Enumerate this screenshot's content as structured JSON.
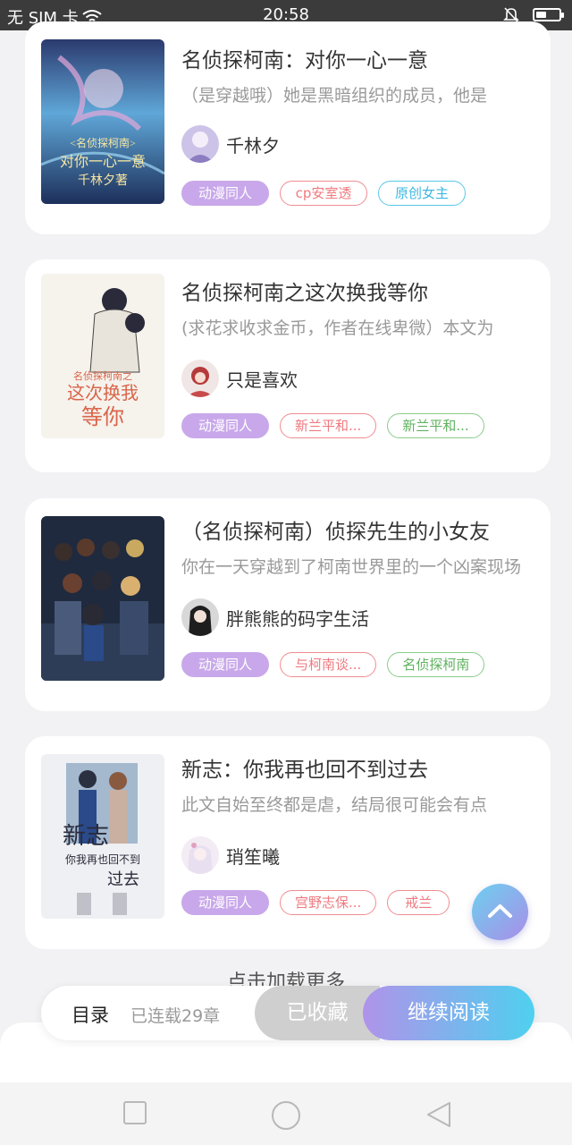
{
  "status_bar": {
    "carrier": "无 SIM 卡",
    "time": "20:58",
    "battery_level": 0.45
  },
  "books": [
    {
      "title": "名侦探柯南：对你一心一意",
      "description": "（是穿越哦）她是黑暗组织的成员，他是",
      "author": "千林夕",
      "tags": [
        "动漫同人",
        "cp安室透",
        "原创女主"
      ],
      "cover_text": [
        "<名侦探柯南>",
        "对你一心一意",
        "千林夕著"
      ]
    },
    {
      "title": "名侦探柯南之这次换我等你",
      "description": "(求花求收求金币，作者在线卑微）本文为",
      "author": "只是喜欢",
      "tags": [
        "动漫同人",
        "新兰平和...",
        "新兰平和..."
      ],
      "cover_text": [
        "名侦探柯南之",
        "这次换我",
        "等你"
      ]
    },
    {
      "title": "（名侦探柯南）侦探先生的小女友",
      "description": "你在一天穿越到了柯南世界里的一个凶案现场",
      "author": "胖熊熊的码字生活",
      "tags": [
        "动漫同人",
        "与柯南谈...",
        "名侦探柯南"
      ],
      "cover_text": []
    },
    {
      "title": "新志：你我再也回不到过去",
      "description": "此文自始至终都是虐，结局很可能会有点",
      "author": "琑笙曦",
      "tags": [
        "动漫同人",
        "宫野志保...",
        "戒兰"
      ],
      "cover_text": [
        "新志",
        "你我再也回不到",
        "过去"
      ]
    }
  ],
  "load_more": "点击加载更多",
  "action_bar": {
    "toc": "目录",
    "serial": "已连载29章",
    "favorited": "已收藏",
    "continue": "继续阅读"
  },
  "colors": {
    "tag_primary": "#c8a8ea",
    "tag_red": "#ef7a80",
    "tag_blue": "#3cb8e0",
    "tag_green": "#5fb25f",
    "accent_gradient_start": "#b093ea",
    "accent_gradient_end": "#4fd0ef"
  },
  "icons": {
    "wifi": "wifi-icon",
    "bell_off": "bell-off-icon",
    "battery": "battery-icon",
    "scroll_top": "chevron-up-icon",
    "nav_recent": "square-icon",
    "nav_home": "circle-icon",
    "nav_back": "triangle-back-icon"
  }
}
